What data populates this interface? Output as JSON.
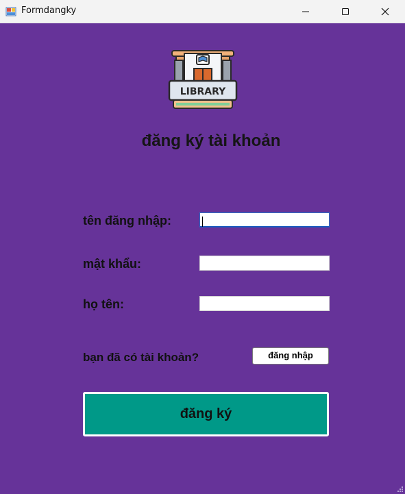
{
  "window": {
    "title": "Formdangky"
  },
  "form": {
    "heading": "đăng ký tài khoản",
    "username_label": "tên đăng nhập:",
    "password_label": "mật khẩu:",
    "fullname_label": "họ tên:",
    "username_value": "",
    "password_value": "",
    "fullname_value": "",
    "have_account_text": "bạn đã có tài khoản?",
    "login_button": "đăng nhập",
    "register_button": "đăng ký"
  },
  "logo": {
    "text": "LIBRARY"
  },
  "colors": {
    "background": "#663399",
    "register_button": "#009988"
  }
}
